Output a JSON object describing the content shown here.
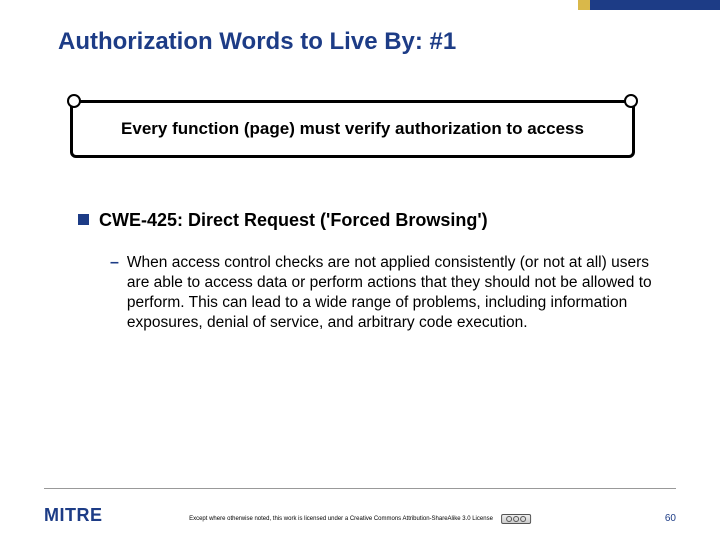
{
  "title": "Authorization Words to Live By: #1",
  "banner": "Every function (page) must verify authorization to access",
  "bullet": "CWE-425: Direct Request ('Forced Browsing')",
  "sub": "When access control checks are not applied consistently (or not at all) users are able to access data or perform actions that they should not be allowed to perform. This can lead to a wide range of problems, including information exposures, denial of service, and arbitrary code execution.",
  "logo": "MITRE",
  "license": "Except where otherwise noted, this work is licensed under a Creative Commons Attribution-ShareAlike 3.0 License",
  "pagenum": "60"
}
